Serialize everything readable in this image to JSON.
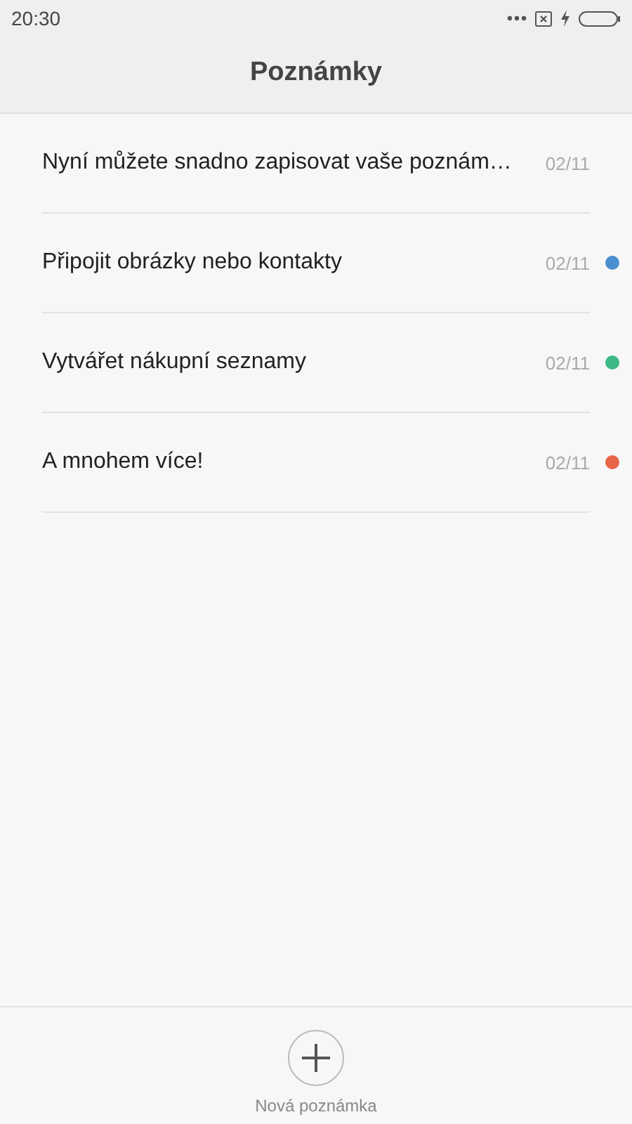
{
  "status_bar": {
    "time": "20:30"
  },
  "header": {
    "title": "Poznámky"
  },
  "notes": [
    {
      "title": "Nyní můžete snadno zapisovat vaše poznám…",
      "date": "02/11"
    },
    {
      "title": "Připojit obrázky nebo kontakty",
      "date": "02/11",
      "color": "#4a90d0"
    },
    {
      "title": "Vytvářet nákupní seznamy",
      "date": "02/11",
      "color": "#3db886"
    },
    {
      "title": "A mnohem více!",
      "date": "02/11",
      "color": "#e8654a"
    }
  ],
  "new_note": {
    "label": "Nová poznámka"
  }
}
